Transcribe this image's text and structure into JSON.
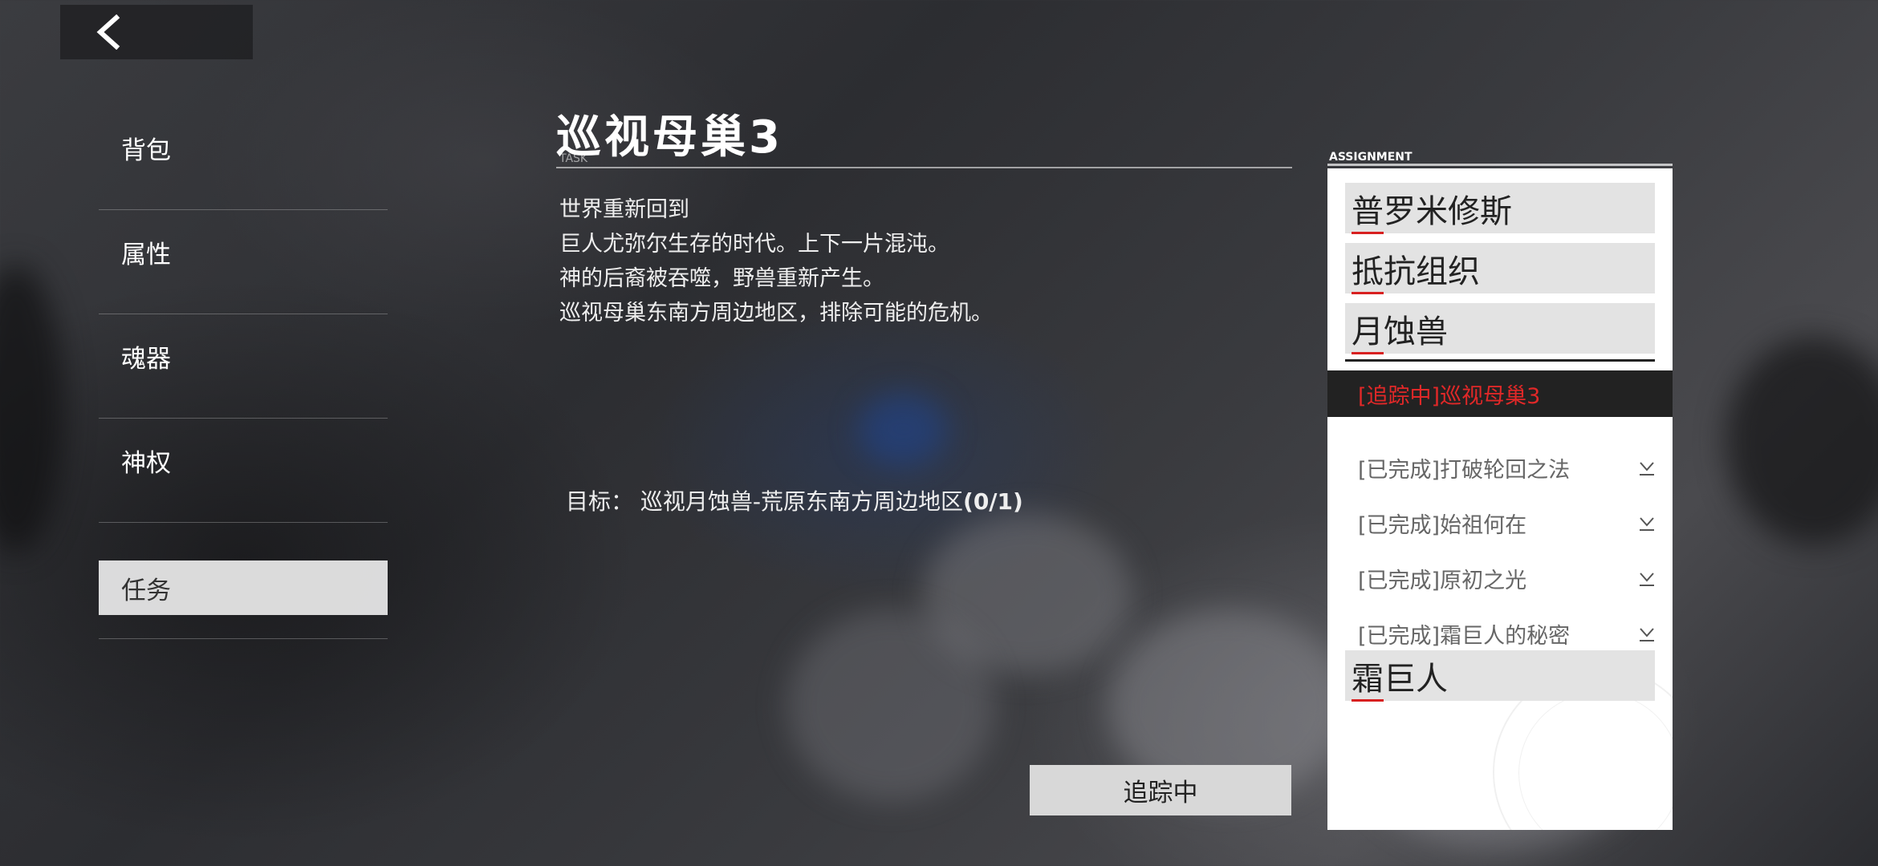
{
  "back": {
    "icon": "back-chevron-icon"
  },
  "menu": {
    "items": [
      {
        "label": "背包"
      },
      {
        "label": "属性"
      },
      {
        "label": "魂器"
      },
      {
        "label": "神权"
      },
      {
        "label": "任务"
      }
    ],
    "active_index": 4
  },
  "task": {
    "title": "巡视母巢3",
    "title_sub": "TASK",
    "description": [
      "世界重新回到",
      "巨人尤弥尔生存的时代。上下一片混沌。",
      "神的后裔被吞噬，野兽重新产生。",
      "巡视母巢东南方周边地区，排除可能的危机。"
    ],
    "goal_prefix": "目标：  巡视月蚀兽-荒原东南方周边地区",
    "goal_progress": "(0/1)",
    "track_button": "追踪中"
  },
  "assignment": {
    "label": "ASSIGNMENT",
    "categories_top": [
      {
        "first": "普",
        "rest": "罗米修斯"
      },
      {
        "first": "抵",
        "rest": "抗组织"
      },
      {
        "first": "月",
        "rest": "蚀兽"
      }
    ],
    "tracking": "[追踪中]巡视母巢3",
    "completed": [
      {
        "label": "[已完成]打破轮回之法"
      },
      {
        "label": "[已完成]始祖何在"
      },
      {
        "label": "[已完成]原初之光"
      },
      {
        "label": "[已完成]霜巨人的秘密"
      }
    ],
    "category_bottom": {
      "first": "霜",
      "rest": "巨人"
    }
  },
  "colors": {
    "tracking": "#e02828",
    "active_menu": "#ebebeb",
    "underline": "#d82020"
  }
}
